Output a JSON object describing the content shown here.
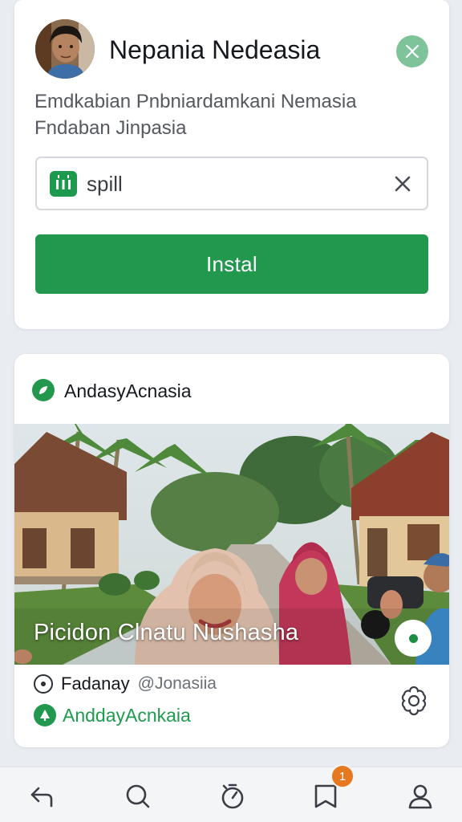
{
  "profile": {
    "name": "Nepania Nedeasia",
    "description": "Emdkabian Pnbniardamkani Nemasia Fndaban Jinpasia",
    "badge_icon": "leaf-pin-icon"
  },
  "search": {
    "value": "spill",
    "icon": "store-icon",
    "clear_icon": "close-icon"
  },
  "install_button": {
    "label": "Instal"
  },
  "feed": {
    "source_name": "AndasyAcnasia",
    "photo_caption": "Picidon Clnatu Nushasha",
    "author_name": "Fadanay",
    "author_handle": "@Jonasiia",
    "tag_label": "AnddayAcnkaia"
  },
  "bottom_nav": {
    "items": [
      "back-icon",
      "search-icon",
      "timer-icon",
      "bookmark-icon",
      "profile-icon"
    ],
    "notification_badge": "1"
  },
  "colors": {
    "accent_green": "#22984f",
    "badge_orange": "#e6781f",
    "background": "#e9edf2"
  }
}
